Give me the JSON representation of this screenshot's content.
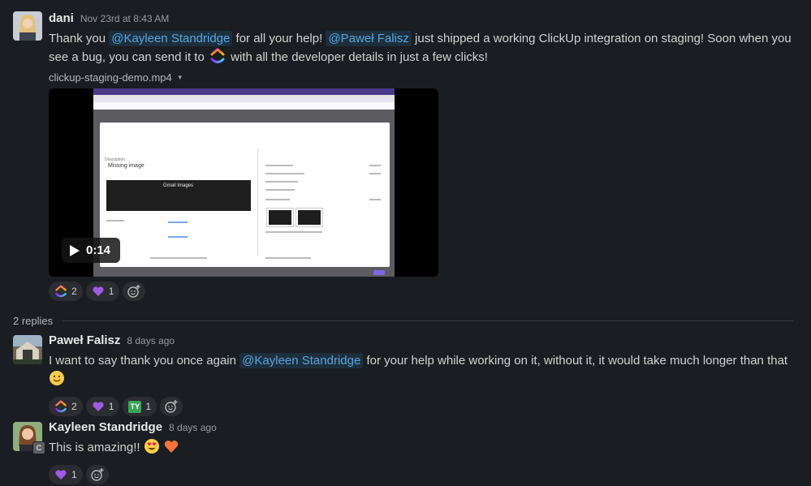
{
  "messages": [
    {
      "author": "dani",
      "time": "Nov 23rd at 8:43 AM",
      "text_parts": {
        "p1": "Thank you",
        "m1": "@Kayleen Standridge",
        "p2": "for all your help!",
        "m2": "@Paweł Falisz",
        "p3": "just shipped a working ClickUp integration on staging! Soon when you see a bug, you can send it to",
        "p4": "with all the developer details in just a few clicks!"
      },
      "inline_icon": "clickup-logo-icon",
      "attachment": {
        "file_name": "clickup-staging-demo.mp4",
        "duration": "0:14",
        "preview_text": {
          "title": "Missing image",
          "mini": "Gmail   Images"
        }
      },
      "reactions": [
        {
          "icon": "clickup-logo-icon",
          "count": "2"
        },
        {
          "icon": "purple-heart-icon",
          "count": "1"
        }
      ]
    },
    {
      "author": "Paweł Falisz",
      "time": "8 days ago",
      "text_parts": {
        "p1": "I want to say thank you once again",
        "m1": "@Kayleen Standridge",
        "p2": "for your help while working on it, without it, it would take much longer than that"
      },
      "emoji": "slightly-smiling-face-icon",
      "reactions": [
        {
          "icon": "clickup-logo-icon",
          "count": "2"
        },
        {
          "icon": "purple-heart-icon",
          "count": "1"
        },
        {
          "icon": "ty-icon",
          "count": "1",
          "label": "TY"
        }
      ]
    },
    {
      "author": "Kayleen Standridge",
      "time": "8 days ago",
      "badge": "C",
      "text": "This is amazing!!",
      "emojis": [
        "heart-eyes-icon",
        "orange-heart-icon"
      ],
      "reactions": [
        {
          "icon": "purple-heart-icon",
          "count": "1"
        }
      ]
    }
  ],
  "thread": {
    "replies_label": "2 replies"
  },
  "colors": {
    "background": "#1a1d21",
    "mention": "#58a6e0",
    "mention_bg": "#1d2f3d",
    "reaction_bg": "#2b2d31"
  }
}
